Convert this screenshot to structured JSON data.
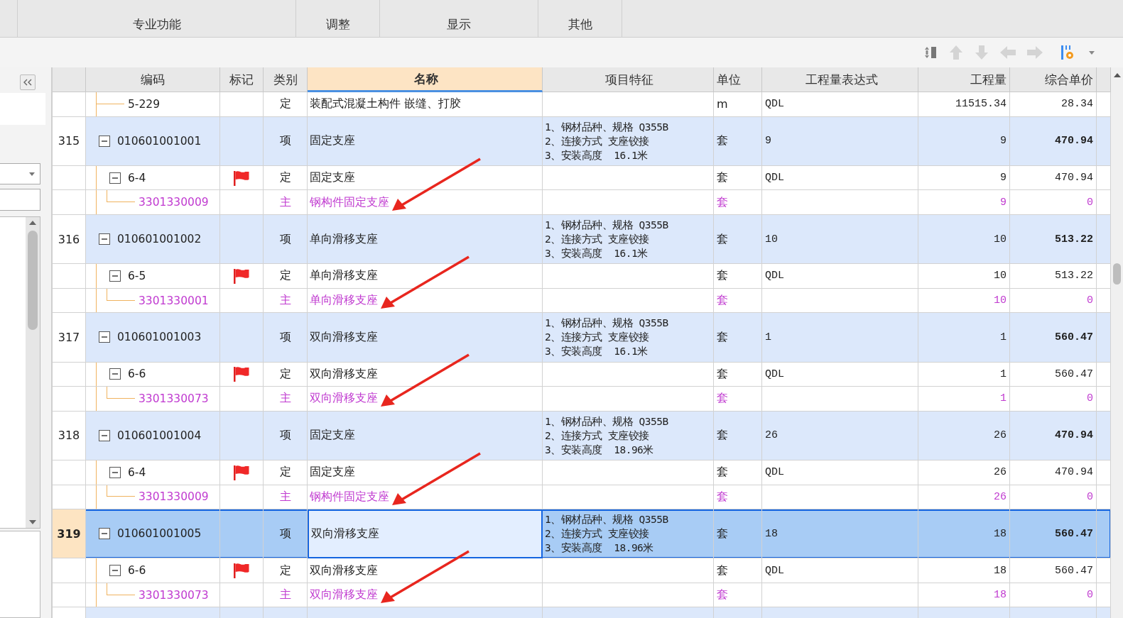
{
  "ribbon": {
    "groups": [
      "专业功能",
      "调整",
      "显示",
      "其他"
    ]
  },
  "table": {
    "columns": [
      {
        "label": "编码",
        "selected": false
      },
      {
        "label": "标记",
        "selected": false
      },
      {
        "label": "类别",
        "selected": false
      },
      {
        "label": "名称",
        "selected": true
      },
      {
        "label": "项目特征",
        "selected": false
      },
      {
        "label": "单位",
        "selected": false
      },
      {
        "label": "工程量表达式",
        "selected": false
      },
      {
        "label": "工程量",
        "selected": false
      },
      {
        "label": "综合单价",
        "selected": false
      }
    ],
    "rows": [
      {
        "kind": "continuation",
        "code": "5-229",
        "type": "定",
        "name": "装配式混凝土构件 嵌缝、打胶",
        "unit": "m",
        "expr": "QDL",
        "qty": "11515.34",
        "price": "28.34",
        "selected": false
      },
      {
        "kind": "item",
        "num": "315",
        "code": "010601001001",
        "type": "项",
        "name": "固定支座",
        "features": [
          "1、钢材品种、规格 Q355B",
          "2、连接方式 支座铰接",
          "3、安装高度  16.1米"
        ],
        "unit": "套",
        "expr": "9",
        "qty": "9",
        "price": "470.94",
        "expanded": true,
        "selected": false,
        "children": [
          {
            "kind": "quota",
            "code": "6-4",
            "flag": true,
            "type": "定",
            "name": "固定支座",
            "unit": "套",
            "expr": "QDL",
            "qty": "9",
            "price": "470.94",
            "expanded": true,
            "selected": false,
            "children": [
              {
                "kind": "material",
                "code": "3301330009",
                "type": "主",
                "name": "钢构件固定支座",
                "unit": "套",
                "qty": "9",
                "price": "0",
                "arrow": true,
                "selected": false
              }
            ]
          }
        ]
      },
      {
        "kind": "item",
        "num": "316",
        "code": "010601001002",
        "type": "项",
        "name": "单向滑移支座",
        "features": [
          "1、钢材品种、规格 Q355B",
          "2、连接方式 支座铰接",
          "3、安装高度  16.1米"
        ],
        "unit": "套",
        "expr": "10",
        "qty": "10",
        "price": "513.22",
        "expanded": true,
        "selected": false,
        "children": [
          {
            "kind": "quota",
            "code": "6-5",
            "flag": true,
            "type": "定",
            "name": "单向滑移支座",
            "unit": "套",
            "expr": "QDL",
            "qty": "10",
            "price": "513.22",
            "expanded": true,
            "selected": false,
            "children": [
              {
                "kind": "material",
                "code": "3301330001",
                "type": "主",
                "name": "单向滑移支座",
                "unit": "套",
                "qty": "10",
                "price": "0",
                "arrow": true,
                "selected": false
              }
            ]
          }
        ]
      },
      {
        "kind": "item",
        "num": "317",
        "code": "010601001003",
        "type": "项",
        "name": "双向滑移支座",
        "features": [
          "1、钢材品种、规格 Q355B",
          "2、连接方式 支座铰接",
          "3、安装高度  16.1米"
        ],
        "unit": "套",
        "expr": "1",
        "qty": "1",
        "price": "560.47",
        "expanded": true,
        "selected": false,
        "children": [
          {
            "kind": "quota",
            "code": "6-6",
            "flag": true,
            "type": "定",
            "name": "双向滑移支座",
            "unit": "套",
            "expr": "QDL",
            "qty": "1",
            "price": "560.47",
            "expanded": true,
            "selected": false,
            "children": [
              {
                "kind": "material",
                "code": "3301330073",
                "type": "主",
                "name": "双向滑移支座",
                "unit": "套",
                "qty": "1",
                "price": "0",
                "arrow": true,
                "selected": false
              }
            ]
          }
        ]
      },
      {
        "kind": "item",
        "num": "318",
        "code": "010601001004",
        "type": "项",
        "name": "固定支座",
        "features": [
          "1、钢材品种、规格 Q355B",
          "2、连接方式 支座铰接",
          "3、安装高度  18.96米"
        ],
        "unit": "套",
        "expr": "26",
        "qty": "26",
        "price": "470.94",
        "expanded": true,
        "selected": false,
        "children": [
          {
            "kind": "quota",
            "code": "6-4",
            "flag": true,
            "type": "定",
            "name": "固定支座",
            "unit": "套",
            "expr": "QDL",
            "qty": "26",
            "price": "470.94",
            "expanded": true,
            "selected": false,
            "children": [
              {
                "kind": "material",
                "code": "3301330009",
                "type": "主",
                "name": "钢构件固定支座",
                "unit": "套",
                "qty": "26",
                "price": "0",
                "arrow": true,
                "selected": false
              }
            ]
          }
        ]
      },
      {
        "kind": "item",
        "num": "319",
        "code": "010601001005",
        "type": "项",
        "name": "双向滑移支座",
        "features": [
          "1、钢材品种、规格 Q355B",
          "2、连接方式 支座铰接",
          "3、安装高度  18.96米"
        ],
        "unit": "套",
        "expr": "18",
        "qty": "18",
        "price": "560.47",
        "expanded": true,
        "selected": true,
        "children": [
          {
            "kind": "quota",
            "code": "6-6",
            "flag": true,
            "type": "定",
            "name": "双向滑移支座",
            "unit": "套",
            "expr": "QDL",
            "qty": "18",
            "price": "560.47",
            "expanded": true,
            "selected": false,
            "children": [
              {
                "kind": "material",
                "code": "3301330073",
                "type": "主",
                "name": "双向滑移支座",
                "unit": "套",
                "qty": "18",
                "price": "0",
                "arrow": true,
                "selected": false
              }
            ]
          }
        ]
      },
      {
        "kind": "item_partial",
        "selected": false
      }
    ]
  }
}
